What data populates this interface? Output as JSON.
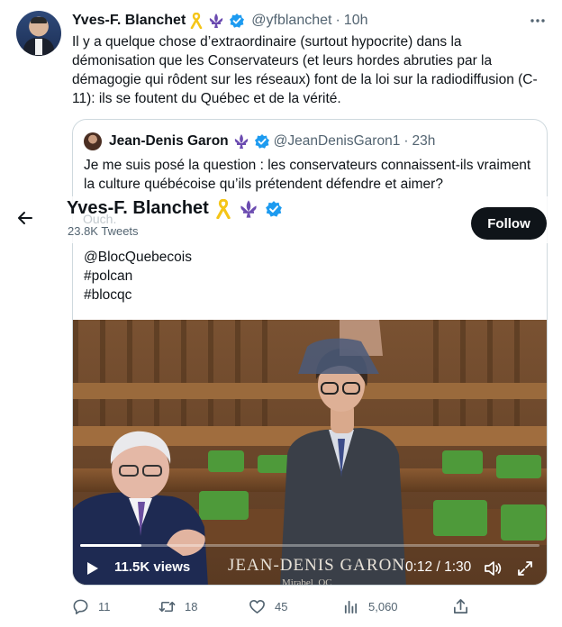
{
  "tweet": {
    "author_name": "Yves-F. Blanchet",
    "handle": "@yfblanchet",
    "separator": "·",
    "time": "10h",
    "text": "Il y a quelque chose d’extraordinaire (surtout hypocrite) dans la démonisation que les Conservateurs (et leurs hordes abruties par la démagogie qui rôdent sur les réseaux) font de la loi sur la radiodiffusion (C-11): ils se foutent du Québec et de la vérité."
  },
  "quote": {
    "author_name": "Jean-Denis Garon",
    "handle": "@JeanDenisGaron1",
    "separator": "·",
    "time": "23h",
    "text": "Je me suis posé la question : les conservateurs connaissent-ils vraiment la culture québécoise qu’ils prétendent défendre et aimer?",
    "tags": [
      "@BlocQuebecois",
      "#polcan",
      "#blocqc"
    ]
  },
  "video": {
    "views": "11.5K views",
    "caption": "JEAN-DENIS GARON",
    "subcaption": "Mirabel, QC",
    "time": "0:12 / 1:30",
    "progress": 0.133
  },
  "profile_header": {
    "name": "Yves-F. Blanchet",
    "tweets_count": "23.8K Tweets",
    "ghost_text": "Ouch. ",
    "follow_label": "Follow"
  },
  "actions": {
    "replies": "11",
    "retweets": "18",
    "likes": "45",
    "views": "5,060"
  },
  "colors": {
    "accent_blue": "#1d9bf0",
    "ribbon_gold": "#f5c518",
    "fleur_purple": "#6b4bb0",
    "text_secondary": "#536471"
  }
}
